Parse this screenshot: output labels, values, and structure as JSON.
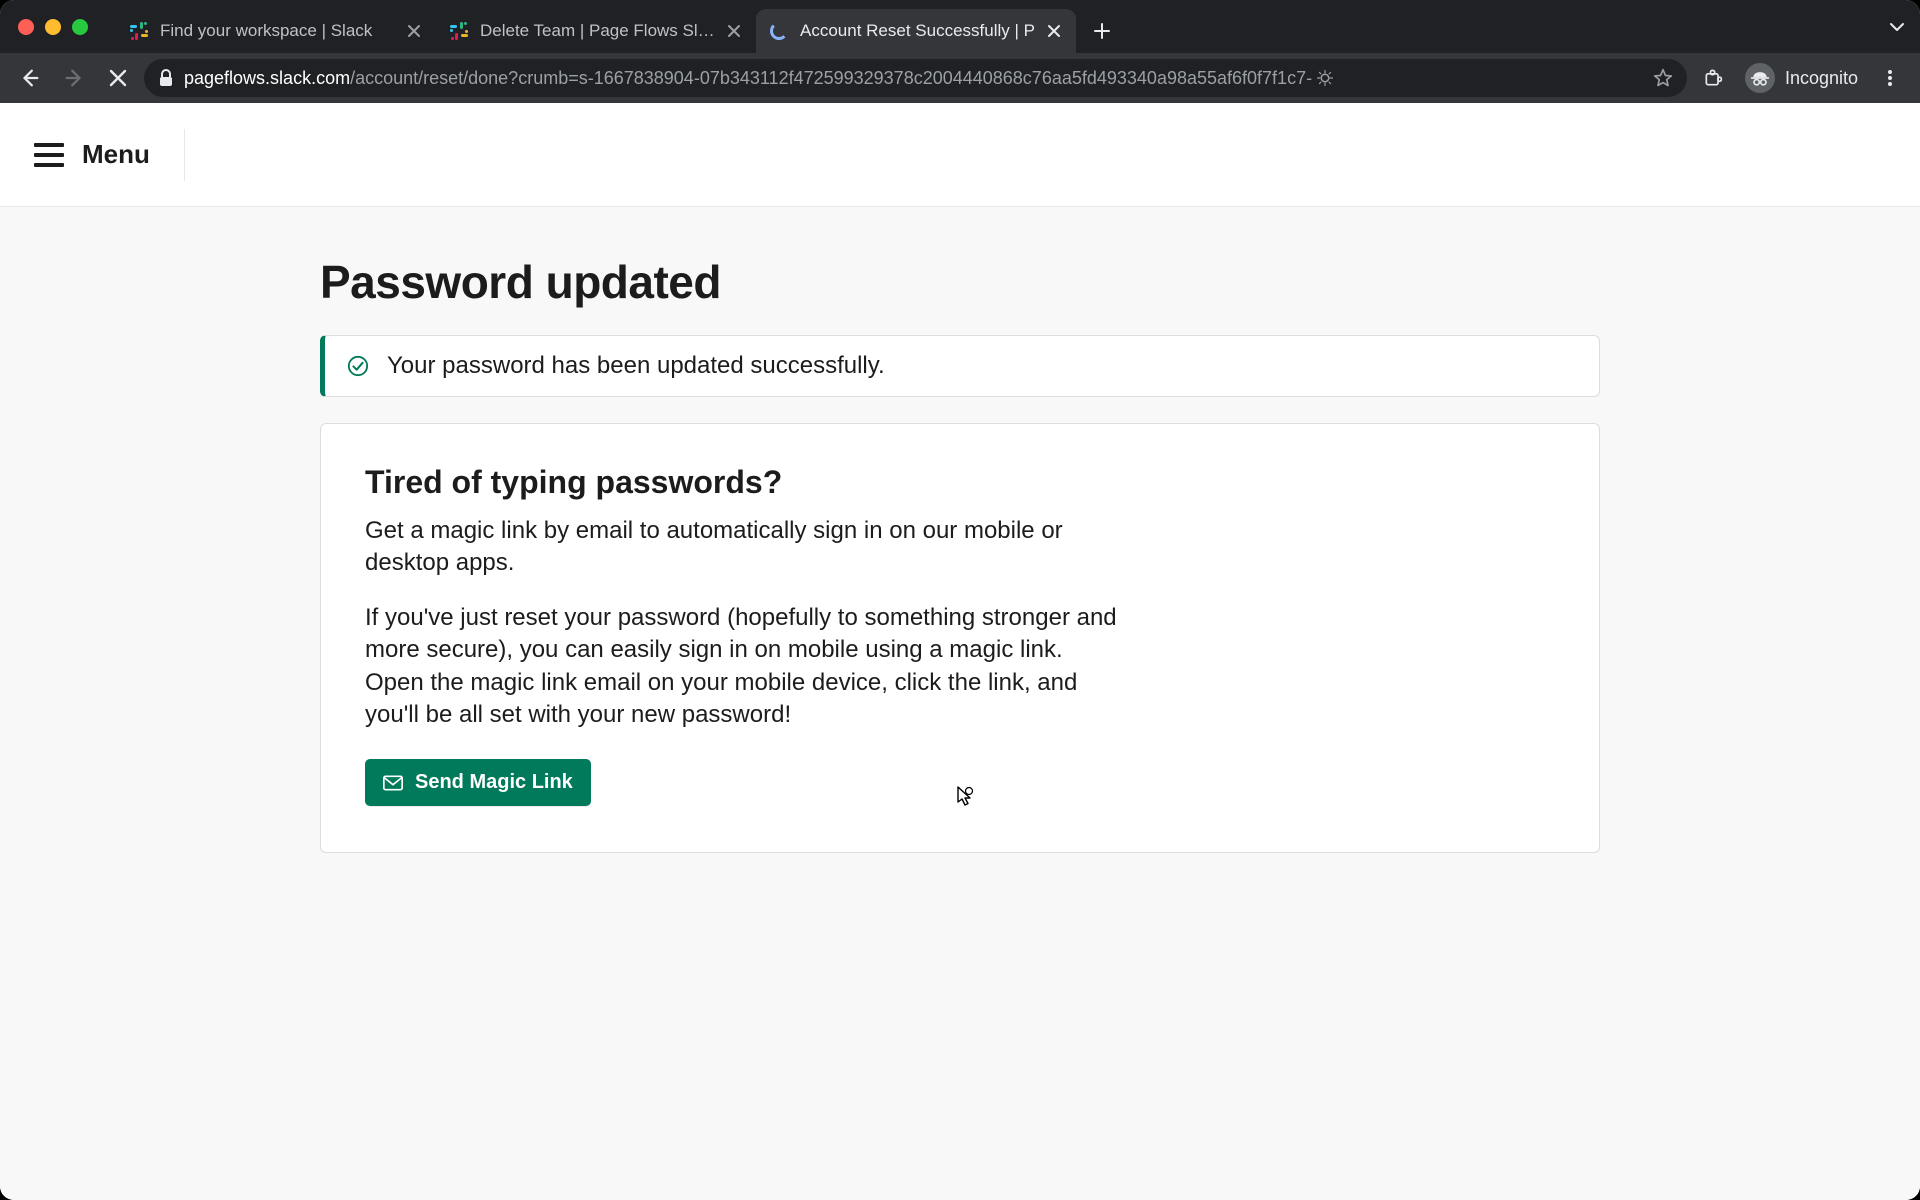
{
  "browser": {
    "tabs": [
      {
        "title": "Find your workspace | Slack",
        "favicon": "slack"
      },
      {
        "title": "Delete Team | Page Flows Slack",
        "favicon": "slack"
      },
      {
        "title": "Account Reset Successfully | P",
        "favicon": "loading",
        "active": true
      }
    ],
    "url_host": "pageflows.slack.com",
    "url_path": "/account/reset/done?crumb=s-1667838904-07b343112f472599329378c2004440868c76aa5fd493340a98a55af6f0f7f1c7-",
    "incognito_label": "Incognito"
  },
  "menu": {
    "label": "Menu"
  },
  "page": {
    "title": "Password updated",
    "alert": "Your password has been updated successfully.",
    "card": {
      "title": "Tired of typing passwords?",
      "p1": "Get a magic link by email to automatically sign in on our mobile or desktop apps.",
      "p2": "If you've just reset your password (hopefully to something stronger and more secure), you can easily sign in on mobile using a magic link. Open the magic link email on your mobile device, click the link, and you'll be all set with your new password!",
      "button": "Send Magic Link"
    }
  }
}
